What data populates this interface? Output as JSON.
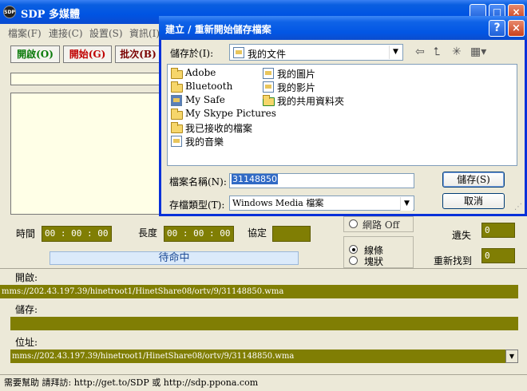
{
  "main": {
    "title": "SDP 多媒體",
    "icon_label": "SDP",
    "menu": [
      "檔案(F)",
      "連接(C)",
      "設置(S)",
      "資訊(I)"
    ],
    "toolbar": {
      "open": "開啟(O)",
      "start": "開始(G)",
      "batch": "批次(B)"
    },
    "labels": {
      "time": "時間",
      "length": "長度",
      "protocol": "協定",
      "lost": "遺失",
      "refound": "重新找到"
    },
    "time_value": "00 : 00 : 00",
    "length_value": "00 : 00 : 00",
    "protocol_value": "",
    "status": "待命中",
    "network_off": "網路 Off",
    "radio_lines": "線條",
    "radio_blocks": "塊狀",
    "lost_value": "0",
    "refound_value": "0",
    "open_label": "開啟:",
    "open_url": "mms://202.43.197.39/hinetroot1/HinetShare08/ortv/9/31148850.wma",
    "save_label": "儲存:",
    "save_path": "",
    "address_label": "位址:",
    "address_url": "mms://202.43.197.39/hinetroot1/HinetShare08/ortv/9/31148850.wma",
    "help_text": "需要幫助 請拜訪: http://get.to/SDP 或 http://sdp.ppona.com"
  },
  "dialog": {
    "title": "建立 / 重新開始儲存檔案",
    "save_in_label": "儲存於(I):",
    "save_in_value": "我的文件",
    "files_col1": [
      "Adobe",
      "Bluetooth",
      "My Safe",
      "My Skype Pictures",
      "我已接收的檔案",
      "我的音樂"
    ],
    "files_col2": [
      "我的圖片",
      "我的影片",
      "我的共用資料夾"
    ],
    "filename_label": "檔案名稱(N):",
    "filename_value": "31148850",
    "filetype_label": "存檔類型(T):",
    "filetype_value": "Windows Media 檔案",
    "save_button": "儲存(S)",
    "cancel_button": "取消"
  },
  "colors": {
    "olive": "#807e04",
    "xp_blue": "#0054e3",
    "dialog_border": "#0831d9"
  }
}
